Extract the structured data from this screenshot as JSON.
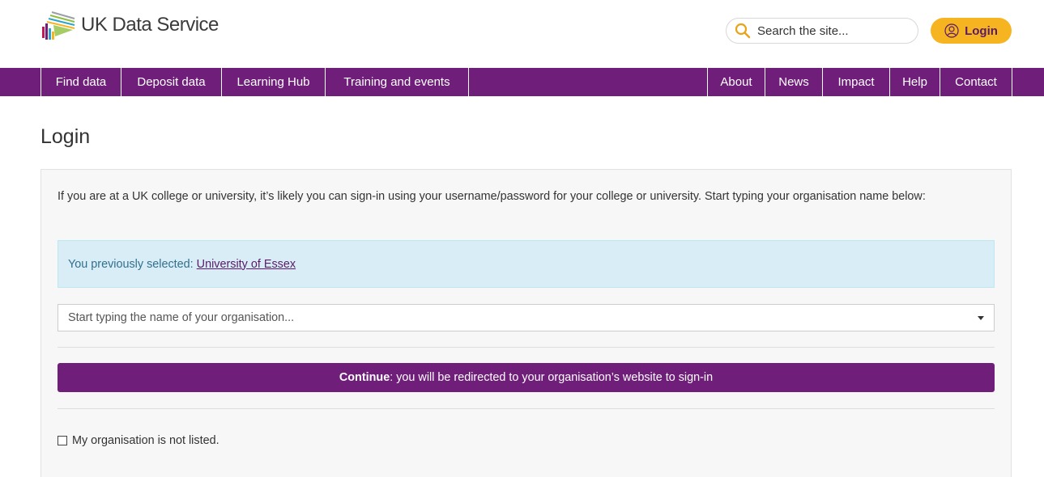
{
  "header": {
    "logo_text": "UK Data Service",
    "search_placeholder": "Search the site...",
    "login_label": "Login"
  },
  "nav": {
    "left_items": [
      "Find data",
      "Deposit data",
      "Learning Hub",
      "Training and events"
    ],
    "right_items": [
      "About",
      "News",
      "Impact",
      "Help",
      "Contact"
    ]
  },
  "page": {
    "title": "Login",
    "intro": "If you are at a UK college or university, it’s likely you can sign-in using your username/password for your college or university. Start typing your organisation name below:",
    "previous_label": "You previously selected:",
    "previous_org": "University of Essex",
    "org_placeholder": "Start typing the name of your organisation...",
    "continue_bold": "Continue",
    "continue_rest": ": you will be redirected to your organisation’s website to sign-in",
    "not_listed_label": "My organisation is not listed."
  },
  "colors": {
    "brand_purple": "#6f1e7a",
    "login_yellow": "#f7b421",
    "alert_bg": "#d9edf7",
    "alert_text": "#31708f"
  }
}
